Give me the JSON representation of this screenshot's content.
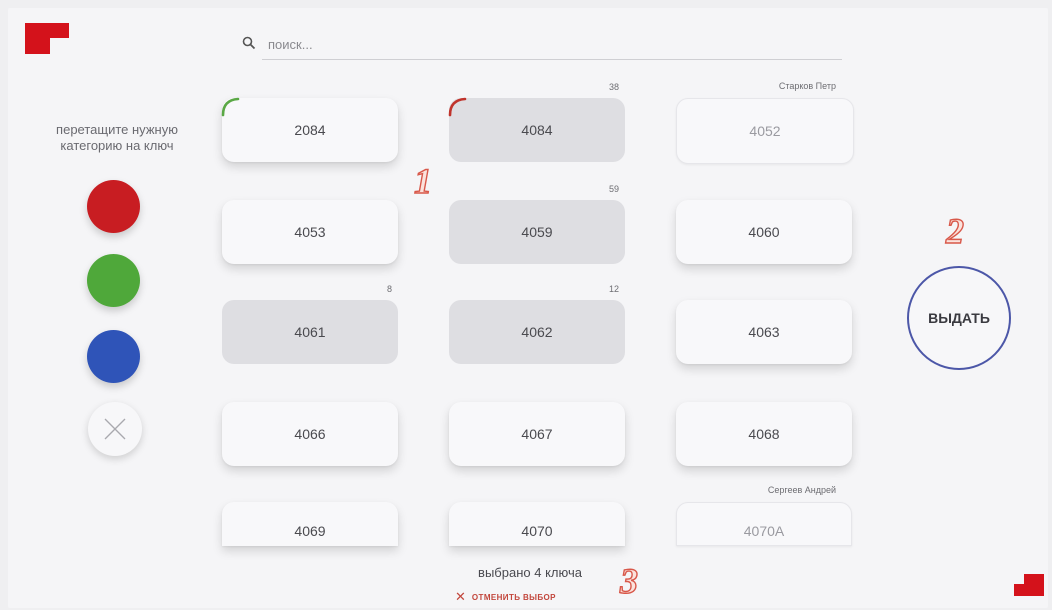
{
  "search": {
    "placeholder": "поиск...",
    "icon": "search-icon"
  },
  "hint": {
    "text": "перетащите нужную категорию на ключ"
  },
  "categories": [
    {
      "name": "red",
      "color": "#c81d22"
    },
    {
      "name": "green",
      "color": "#4fa83a"
    },
    {
      "name": "blue",
      "color": "#2f54b8"
    }
  ],
  "keys": [
    {
      "number": "2084",
      "count": "",
      "owner": "",
      "state": "default",
      "indicator": "#5aa845"
    },
    {
      "number": "4084",
      "count": "38",
      "owner": "",
      "state": "selected",
      "indicator": "#c0332b"
    },
    {
      "number": "4052",
      "count": "",
      "owner": "Старков Петр",
      "state": "issued",
      "indicator": ""
    },
    {
      "number": "4053",
      "count": "",
      "owner": "",
      "state": "default",
      "indicator": ""
    },
    {
      "number": "4059",
      "count": "59",
      "owner": "",
      "state": "selected",
      "indicator": ""
    },
    {
      "number": "4060",
      "count": "",
      "owner": "",
      "state": "default",
      "indicator": ""
    },
    {
      "number": "4061",
      "count": "8",
      "owner": "",
      "state": "selected",
      "indicator": ""
    },
    {
      "number": "4062",
      "count": "12",
      "owner": "",
      "state": "selected",
      "indicator": ""
    },
    {
      "number": "4063",
      "count": "",
      "owner": "",
      "state": "default",
      "indicator": ""
    },
    {
      "number": "4066",
      "count": "",
      "owner": "",
      "state": "default",
      "indicator": ""
    },
    {
      "number": "4067",
      "count": "",
      "owner": "",
      "state": "default",
      "indicator": ""
    },
    {
      "number": "4068",
      "count": "",
      "owner": "",
      "state": "default",
      "indicator": ""
    },
    {
      "number": "4069",
      "count": "",
      "owner": "",
      "state": "default",
      "indicator": ""
    },
    {
      "number": "4070",
      "count": "",
      "owner": "",
      "state": "default",
      "indicator": ""
    },
    {
      "number": "4070A",
      "count": "",
      "owner": "Сергеев Андрей",
      "state": "issued",
      "indicator": ""
    }
  ],
  "annotations": {
    "a1": "1",
    "a2": "2",
    "a3": "3"
  },
  "issue_button": {
    "label": "ВЫДАТЬ"
  },
  "footer": {
    "selected_text": "выбрано 4 ключа",
    "cancel_label": "отменить выбор"
  },
  "colors": {
    "brand": "#d4121b",
    "accent_border": "#4c57a8",
    "cancel": "#c2463c"
  }
}
